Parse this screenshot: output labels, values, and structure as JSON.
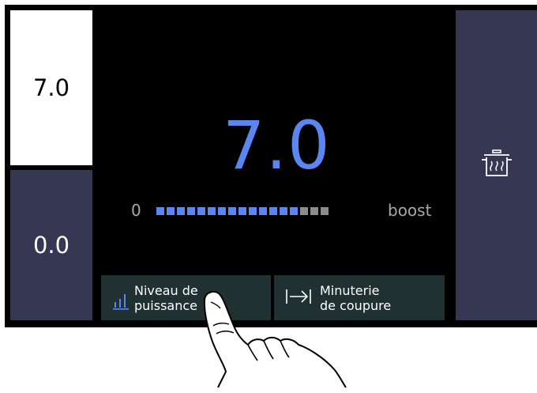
{
  "zones": {
    "top_value": "7.0",
    "bottom_value": "0.0"
  },
  "display": {
    "big_value": "7.0",
    "scale_min": "0",
    "scale_max": "boost"
  },
  "level": {
    "filled": 14,
    "total": 17,
    "filled_color": "#5b86ef",
    "empty_color": "#8c8c8c"
  },
  "buttons": {
    "power_line1": "Niveau de",
    "power_line2": "puissance",
    "timer_line1": "Minuterie",
    "timer_line2": "de coupure"
  },
  "icons": {
    "power": "power-level-bars-icon",
    "timer": "arrow-to-bar-icon",
    "pot": "cooking-pot-steam-icon",
    "pointer": "pointing-hand-icon"
  },
  "colors": {
    "accent": "#5b86ef",
    "panel": "#000000",
    "zone_dark": "#363752",
    "button_bg": "#213030"
  }
}
